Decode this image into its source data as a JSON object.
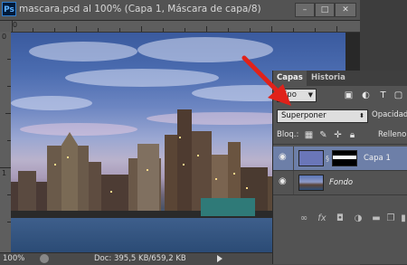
{
  "app": {
    "logo": "Ps"
  },
  "document": {
    "title": "mascara.psd al 100% (Capa 1, Máscara de capa/8)",
    "window_buttons": {
      "minimize": "–",
      "maximize": "□",
      "close": "✕"
    }
  },
  "rulers": {
    "top_zero": "0",
    "left_zero": "0",
    "left_one": "1"
  },
  "status_bar": {
    "zoom": "100%",
    "doc_size": "Doc: 395,5 KB/659,2 KB"
  },
  "layers_panel": {
    "tabs": [
      {
        "label": "Capas"
      },
      {
        "label": "Historia"
      }
    ],
    "filter": {
      "label": "Tipo",
      "icons": [
        "image-filter-icon",
        "adjustment-filter-icon",
        "type-filter-icon",
        "shape-filter-icon"
      ]
    },
    "blend_mode": {
      "value": "Superponer"
    },
    "opacity_label": "Opacidad:",
    "lock_label": "Bloq.:",
    "fill_label": "Relleno:",
    "layers": [
      {
        "name": "Capa 1",
        "selected": true
      },
      {
        "name": "Fondo",
        "selected": false
      }
    ],
    "footer_icons": [
      "link-icon",
      "fx-icon",
      "mask-icon",
      "adjustment-icon",
      "folder-icon",
      "new-layer-icon",
      "trash-icon"
    ]
  },
  "annotation": {
    "arrow_color": "#e0221a"
  },
  "colors": {
    "selected_layer": "#6d7fa8",
    "panel_bg": "#535353",
    "doc_bg": "#282828"
  }
}
